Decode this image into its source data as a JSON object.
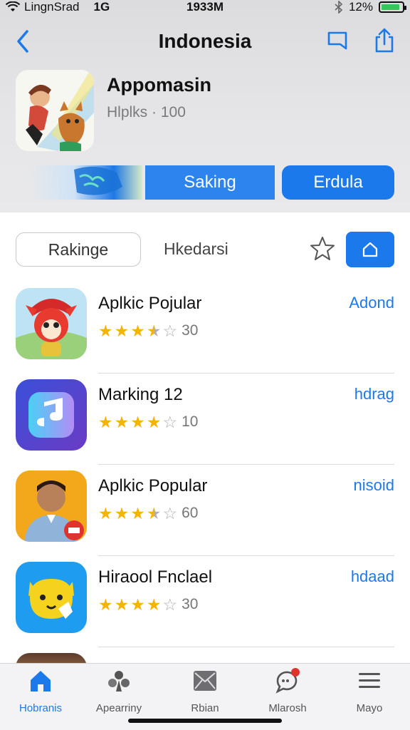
{
  "status_bar": {
    "carrier": "LingnSrad",
    "network": "1G",
    "time": "1933M",
    "battery_percent": "12%",
    "battery_level": 0.9,
    "icons": [
      "wifi-icon",
      "bluetooth-icon",
      "battery-icon"
    ]
  },
  "nav": {
    "title": "Indonesia",
    "back_icon": "chevron-left-icon",
    "bookmark_icon": "bookmark-icon",
    "share_icon": "share-icon"
  },
  "featured": {
    "name": "Appomasin",
    "subtitle": "Hlplks · 100"
  },
  "actions": {
    "saking": "Saking",
    "erdula": "Erdula"
  },
  "segments": {
    "rakinge": "Rakinge",
    "hkedarsi": "Hkedarsi"
  },
  "apps": [
    {
      "name": "Aplkic Pojular",
      "rating": 3.5,
      "count": "30",
      "action": "Adond"
    },
    {
      "name": "Marking 12",
      "rating": 4,
      "count": "10",
      "action": "hdrag"
    },
    {
      "name": "Aplkic Popular",
      "rating": 3.5,
      "count": "60",
      "action": "nisoid"
    },
    {
      "name": "Hiraool Fnclael",
      "rating": 4,
      "count": "30",
      "action": "hdaad"
    }
  ],
  "tabs": [
    {
      "label": "Hobranis",
      "icon": "home-icon",
      "active": true
    },
    {
      "label": "Apearriny",
      "icon": "apps-icon",
      "active": false
    },
    {
      "label": "Rbian",
      "icon": "mail-icon",
      "active": false
    },
    {
      "label": "Mlarosh",
      "icon": "chat-icon",
      "active": false
    },
    {
      "label": "Mayo",
      "icon": "menu-icon",
      "active": false
    }
  ],
  "colors": {
    "accent": "#1c79ec",
    "star": "#f5b400",
    "header_bg": "#e6e6e8"
  }
}
